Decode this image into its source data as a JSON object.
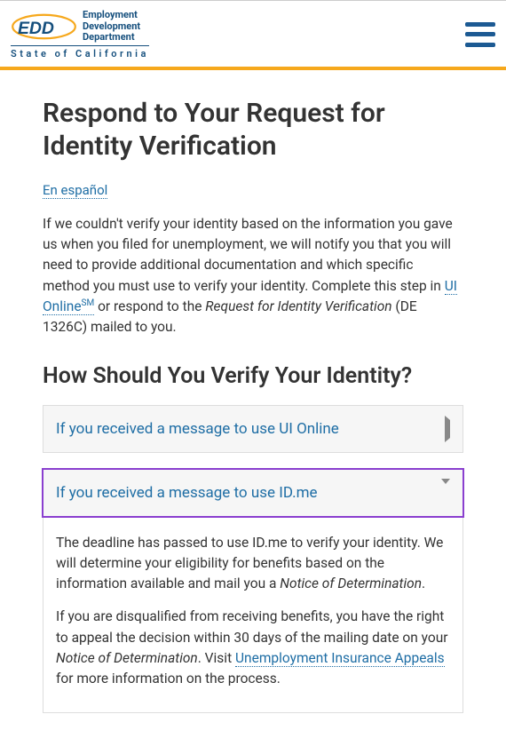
{
  "logo": {
    "line1": "Employment",
    "line2": "Development",
    "line3": "Department",
    "subline": "State of California"
  },
  "page": {
    "title": "Respond to Your Request for Identity Verification",
    "lang_link": "En español",
    "intro_part1": "If we couldn't verify your identity based on the information you gave us when you filed for unemployment, we will notify you that you will need to provide additional documentation and which specific method you must use to verify your identity. Complete this step in ",
    "intro_link": "UI Online",
    "intro_sup": "SM",
    "intro_part2": " or respond to the ",
    "intro_italic": "Request for Identity Verification",
    "intro_part3": " (DE 1326C) mailed to you.",
    "h2": "How Should You Verify Your Identity?"
  },
  "accordion": [
    {
      "title": "If you received a message to use UI Online"
    },
    {
      "title": "If you received a message to use ID.me",
      "body_p1_a": "The deadline has passed to use ID.me to verify your identity. We will determine your eligibility for benefits based on the information available and mail you a ",
      "body_p1_i": "Notice of Determination",
      "body_p1_b": ".",
      "body_p2_a": "If you are disqualified from receiving benefits, you have the right to appeal the decision within 30 days of the mailing date on your ",
      "body_p2_i": "Notice of Determination",
      "body_p2_b": ". Visit ",
      "body_p2_link": "Unemployment Insurance Appeals",
      "body_p2_c": " for more information on the process."
    }
  ]
}
